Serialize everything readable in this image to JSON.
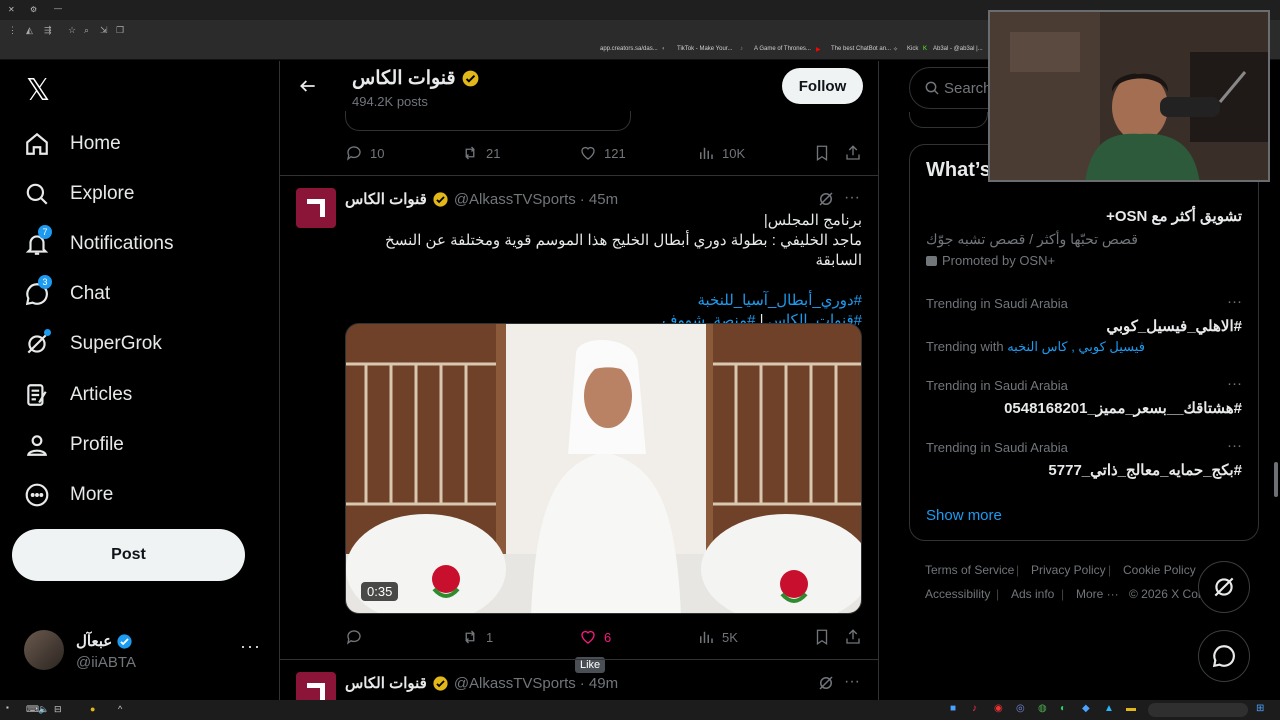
{
  "browser": {
    "bookmarks": [
      "app.creators.sa/das...",
      "TikTok - Make Your...",
      "A Game of Thrones...",
      "The best ChatBot an...",
      "Kick",
      "Ab3al - @ab3al |..."
    ]
  },
  "nav": {
    "items": [
      {
        "label": "Home",
        "icon": "home-icon"
      },
      {
        "label": "Explore",
        "icon": "search-icon"
      },
      {
        "label": "Notifications",
        "icon": "bell-icon",
        "badge": "7"
      },
      {
        "label": "Chat",
        "icon": "chat-icon",
        "badge": "3"
      },
      {
        "label": "SuperGrok",
        "icon": "grok-icon"
      },
      {
        "label": "Articles",
        "icon": "article-icon"
      },
      {
        "label": "Profile",
        "icon": "person-icon"
      },
      {
        "label": "More",
        "icon": "more-circle-icon"
      }
    ],
    "post_label": "Post"
  },
  "account": {
    "display_name": "عبعآل",
    "handle": "@iiABTA"
  },
  "header": {
    "title": "قنوات الكاس",
    "posts_count": "494.2K posts",
    "follow_label": "Follow"
  },
  "prev_tweet": {
    "replies": "10",
    "reposts": "21",
    "likes": "121",
    "views": "10K"
  },
  "tweet": {
    "name": "قنوات الكاس",
    "handle": "@AlkassTVSports",
    "time": "· 45m",
    "line1": "برنامج المجلس|",
    "line2": "ماجد الخليفي : بطولة دوري أبطال الخليج هذا الموسم قوية ومختلفة عن النسخ السابقة",
    "hashtag1": "#دوري_أبطال_آسيا_للنخبة",
    "hashtag2a": "#قنوات_الكاس",
    "hashtag_sep": " | ",
    "hashtag2b": "#منصة_شووف",
    "video_duration": "0:35",
    "replies": "",
    "reposts": "1",
    "likes": "6",
    "views": "5K",
    "tooltip": "Like"
  },
  "next_tweet": {
    "name": "قنوات الكاس",
    "handle": "@AlkassTVSports",
    "time": "· 49m"
  },
  "right": {
    "search_placeholder": "Search",
    "whats_title": "What’s",
    "promo": {
      "title": "تشويق أكثر مع OSN+",
      "subtitle": "قصص تحبّها وأكثر / قصص تشبه جوّك",
      "promoted": "Promoted by OSN+"
    },
    "trends": [
      {
        "meta": "Trending in Saudi Arabia",
        "name": "#الاهلي_فيسيل_كوبي",
        "with_label": "Trending with",
        "with_tags": "فيسيل كوبي , كاس النخبه"
      },
      {
        "meta": "Trending in Saudi Arabia",
        "name": "#هشتاقك__بسعر_مميز_0548168201"
      },
      {
        "meta": "Trending in Saudi Arabia",
        "name": "#بكج_حمايه_معالج_ذاتي_5777"
      }
    ],
    "show_more": "Show more",
    "footer": {
      "terms": "Terms of Service",
      "privacy": "Privacy Policy",
      "cookie": "Cookie Policy",
      "accessibility": "Accessibility",
      "ads": "Ads info",
      "more": "More ···",
      "copyright": "© 2026 X Cor"
    }
  }
}
